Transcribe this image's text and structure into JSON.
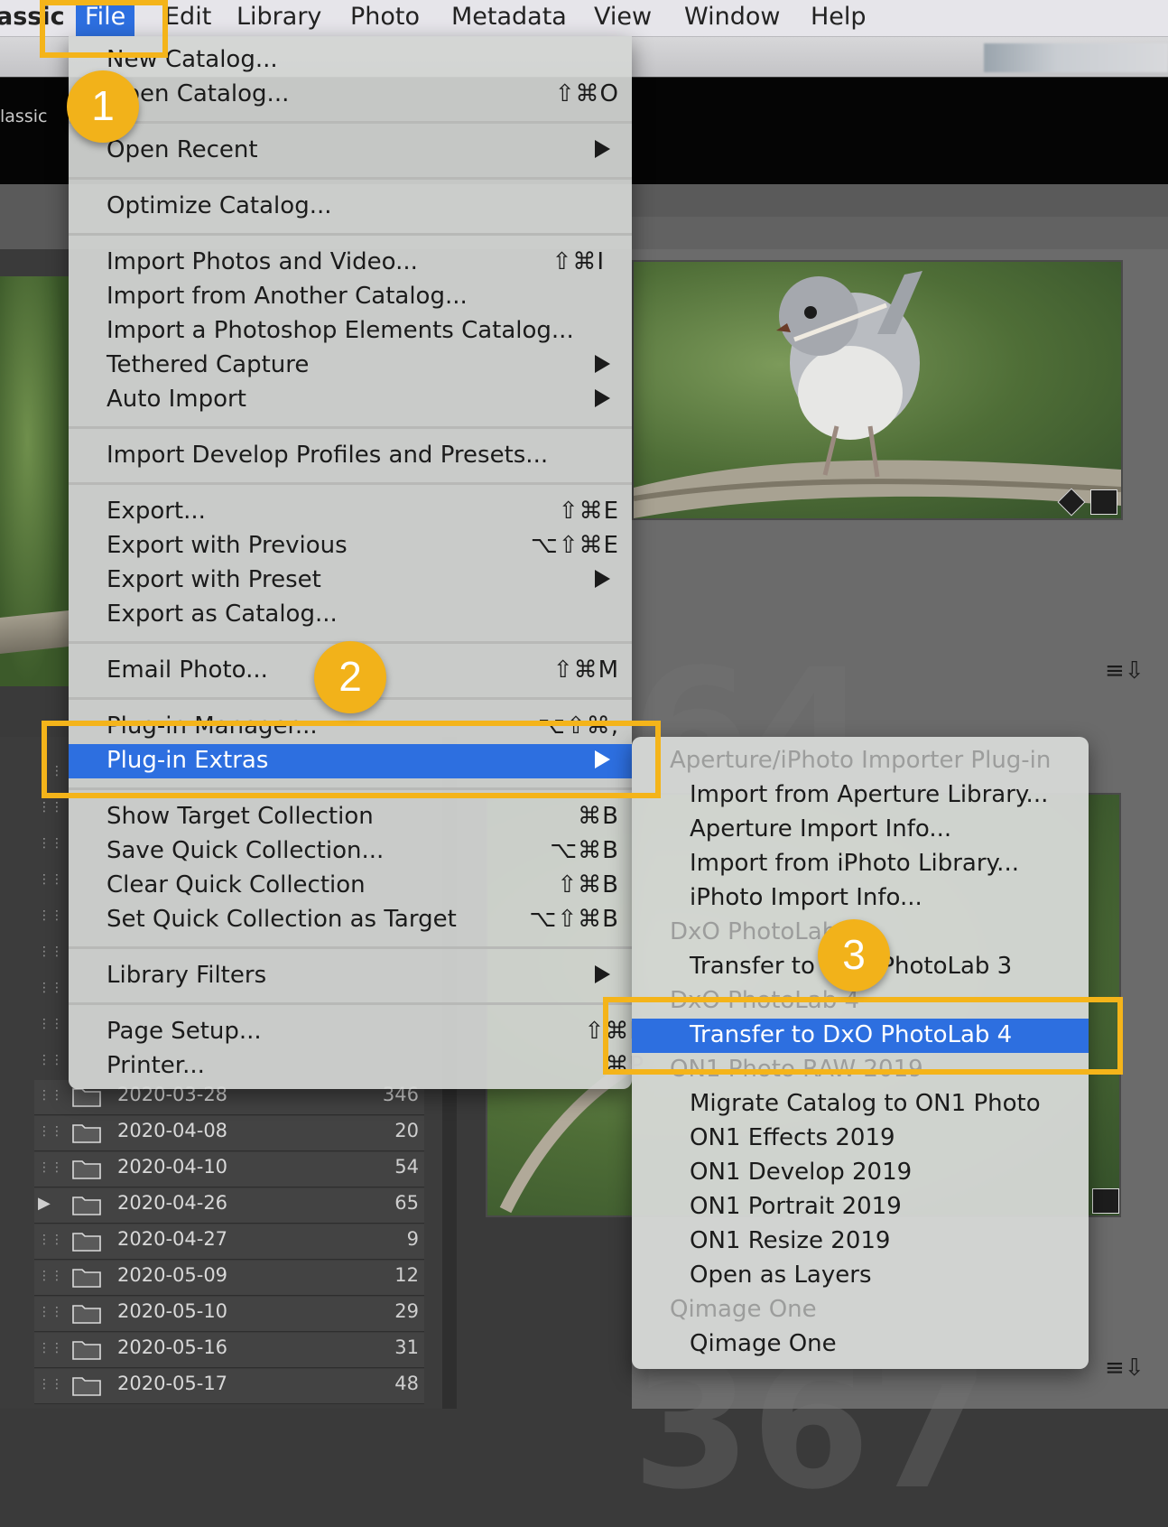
{
  "menubar": {
    "items": [
      {
        "label": "assic"
      },
      {
        "label": "File"
      },
      {
        "label": "Edit"
      },
      {
        "label": "Library"
      },
      {
        "label": "Photo"
      },
      {
        "label": "Metadata"
      },
      {
        "label": "View"
      },
      {
        "label": "Window"
      },
      {
        "label": "Help"
      }
    ]
  },
  "identity": {
    "label": "lassic"
  },
  "file_menu": {
    "items": [
      {
        "label": "New Catalog...",
        "shortcut": ""
      },
      {
        "label": "Open Catalog...",
        "shortcut": "⇧⌘O"
      },
      {
        "label": "Open Recent",
        "shortcut": ""
      },
      {
        "label": "Optimize Catalog...",
        "shortcut": ""
      },
      {
        "label": "Import Photos and Video...",
        "shortcut": "⇧⌘I"
      },
      {
        "label": "Import from Another Catalog...",
        "shortcut": ""
      },
      {
        "label": "Import a Photoshop Elements Catalog...",
        "shortcut": ""
      },
      {
        "label": "Tethered Capture",
        "shortcut": ""
      },
      {
        "label": "Auto Import",
        "shortcut": ""
      },
      {
        "label": "Import Develop Profiles and Presets...",
        "shortcut": ""
      },
      {
        "label": "Export...",
        "shortcut": "⇧⌘E"
      },
      {
        "label": "Export with Previous",
        "shortcut": "⌥⇧⌘E"
      },
      {
        "label": "Export with Preset",
        "shortcut": ""
      },
      {
        "label": "Export as Catalog...",
        "shortcut": ""
      },
      {
        "label": "Email Photo...",
        "shortcut": "⇧⌘M"
      },
      {
        "label": "Plug-in Manager...",
        "shortcut": "⌥⇧⌘,"
      },
      {
        "label": "Plug-in Extras",
        "shortcut": ""
      },
      {
        "label": "Show Target Collection",
        "shortcut": "⌘B"
      },
      {
        "label": "Save Quick Collection...",
        "shortcut": "⌥⌘B"
      },
      {
        "label": "Clear Quick Collection",
        "shortcut": "⇧⌘B"
      },
      {
        "label": "Set Quick Collection as Target",
        "shortcut": "⌥⇧⌘B"
      },
      {
        "label": "Library Filters",
        "shortcut": ""
      },
      {
        "label": "Page Setup...",
        "shortcut": "⇧⌘P"
      },
      {
        "label": "Printer...",
        "shortcut": "⌘P"
      }
    ]
  },
  "submenu": {
    "items": [
      {
        "label": "Aperture/iPhoto Importer Plug-in"
      },
      {
        "label": "Import from Aperture Library..."
      },
      {
        "label": "Aperture Import Info..."
      },
      {
        "label": "Import from iPhoto Library..."
      },
      {
        "label": "iPhoto Import Info..."
      },
      {
        "label": "DxO PhotoLab 3"
      },
      {
        "label": "Transfer to DxO PhotoLab 3"
      },
      {
        "label": "DxO PhotoLab 4"
      },
      {
        "label": "Transfer to DxO PhotoLab 4"
      },
      {
        "label": "ON1 Photo RAW 2019"
      },
      {
        "label": "Migrate Catalog to ON1 Photo"
      },
      {
        "label": "ON1 Effects 2019"
      },
      {
        "label": "ON1 Develop 2019"
      },
      {
        "label": "ON1 Portrait 2019"
      },
      {
        "label": "ON1 Resize 2019"
      },
      {
        "label": "Open as Layers"
      },
      {
        "label": "Qimage One"
      },
      {
        "label": "Qimage One"
      }
    ]
  },
  "folders": [
    {
      "name": "2020-03-28",
      "count": "346"
    },
    {
      "name": "2020-04-08",
      "count": "20"
    },
    {
      "name": "2020-04-10",
      "count": "54"
    },
    {
      "name": "2020-04-26",
      "count": "65"
    },
    {
      "name": "2020-04-27",
      "count": "9"
    },
    {
      "name": "2020-05-09",
      "count": "12"
    },
    {
      "name": "2020-05-10",
      "count": "29"
    },
    {
      "name": "2020-05-16",
      "count": "31"
    },
    {
      "name": "2020-05-17",
      "count": "48"
    }
  ],
  "grid": {
    "cell_number_top": "64",
    "cell_number_bottom": "367"
  },
  "callouts": {
    "one": "1",
    "two": "2",
    "three": "3"
  },
  "colors": {
    "highlight": "#2d6fe0",
    "annotation": "#f4b41a"
  }
}
